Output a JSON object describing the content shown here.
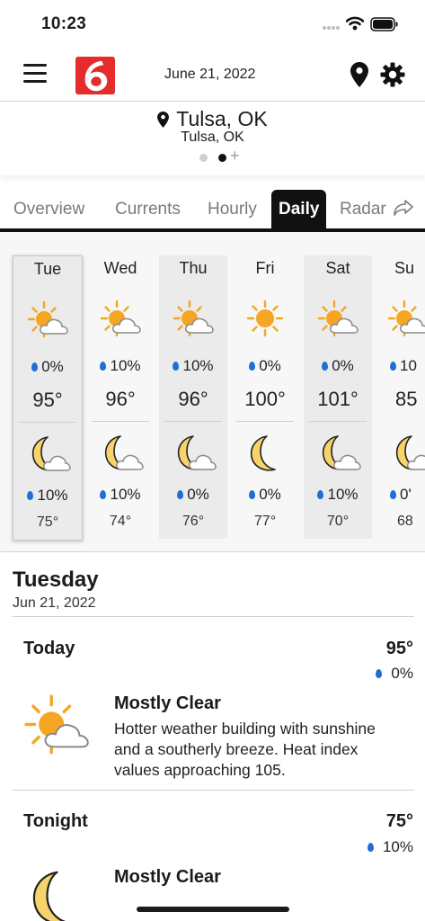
{
  "status_bar": {
    "time": "10:23"
  },
  "header": {
    "date": "June 21, 2022",
    "logo_text": "6"
  },
  "location": {
    "name": "Tulsa, OK",
    "subtitle": "Tulsa, OK",
    "page_index": 1,
    "page_count": 2
  },
  "tabs": [
    {
      "label": "Overview",
      "active": false
    },
    {
      "label": "Currents",
      "active": false
    },
    {
      "label": "Hourly",
      "active": false
    },
    {
      "label": "Daily",
      "active": true
    },
    {
      "label": "Radar",
      "active": false
    }
  ],
  "days": [
    {
      "name": "Tue",
      "day_icon": "partly-cloudy-sun-icon",
      "day_precip": "0%",
      "high": "95°",
      "night_icon": "partly-cloudy-moon-icon",
      "night_precip": "10%",
      "low": "75°"
    },
    {
      "name": "Wed",
      "day_icon": "partly-cloudy-sun-icon",
      "day_precip": "10%",
      "high": "96°",
      "night_icon": "partly-cloudy-moon-icon",
      "night_precip": "10%",
      "low": "74°"
    },
    {
      "name": "Thu",
      "day_icon": "partly-cloudy-sun-icon",
      "day_precip": "10%",
      "high": "96°",
      "night_icon": "partly-cloudy-moon-icon",
      "night_precip": "0%",
      "low": "76°"
    },
    {
      "name": "Fri",
      "day_icon": "sun-icon",
      "day_precip": "0%",
      "high": "100°",
      "night_icon": "moon-icon",
      "night_precip": "0%",
      "low": "77°"
    },
    {
      "name": "Sat",
      "day_icon": "partly-cloudy-sun-icon",
      "day_precip": "0%",
      "high": "101°",
      "night_icon": "partly-cloudy-moon-icon",
      "night_precip": "10%",
      "low": "70°"
    },
    {
      "name": "Su",
      "day_icon": "partly-cloudy-sun-icon",
      "day_precip": "10",
      "high": "85",
      "night_icon": "partly-cloudy-moon-icon",
      "night_precip": "0'",
      "low": "68"
    }
  ],
  "detail": {
    "day_heading": "Tuesday",
    "date": "Jun 21, 2022",
    "today": {
      "label": "Today",
      "temp": "95°",
      "precip": "0%",
      "condition": "Mostly Clear",
      "description": "Hotter weather building with sunshine and a southerly breeze. Heat index values approaching 105."
    },
    "tonight": {
      "label": "Tonight",
      "temp": "75°",
      "precip": "10%",
      "condition": "Mostly Clear"
    }
  },
  "colors": {
    "accent": "#111111",
    "logo": "#e42c2c",
    "sun": "#f5a623",
    "moon": "#f7d36b",
    "drop": "#1f6ed4"
  }
}
